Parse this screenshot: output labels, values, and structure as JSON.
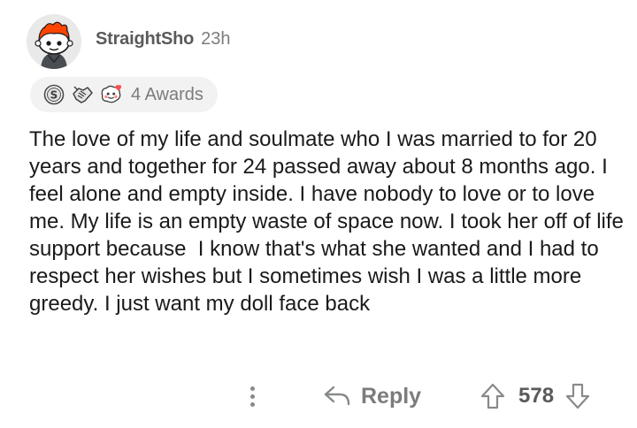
{
  "comment": {
    "username": "StraightSho",
    "age": "23h",
    "avatar": "snoo-avatar",
    "awards": {
      "icons": [
        "silver-award-icon",
        "handshake-award-icon",
        "wholesome-award-icon"
      ],
      "label": "4 Awards"
    },
    "body": "The love of my life and soulmate who I was married to for 20 years and together for 24 passed away about 8 months ago. I feel alone and empty inside. I have nobody to love or to love me. My life is an empty waste of space now. I took her off of life support because  I know that's what she wanted and I had to respect her wishes but I sometimes wish I was a little more greedy. I just want my doll face back",
    "actions": {
      "more_icon": "more-vertical-icon",
      "reply_icon": "reply-arrow-icon",
      "reply_label": "Reply",
      "upvote_icon": "upvote-arrow-icon",
      "score": "578",
      "downvote_icon": "downvote-arrow-icon"
    }
  },
  "colors": {
    "text": "#1a1a1b",
    "meta": "#7c7c7c",
    "icon": "#878a8c",
    "award_pill": "#f2f2f2",
    "avatar_accent": "#ff4500"
  }
}
